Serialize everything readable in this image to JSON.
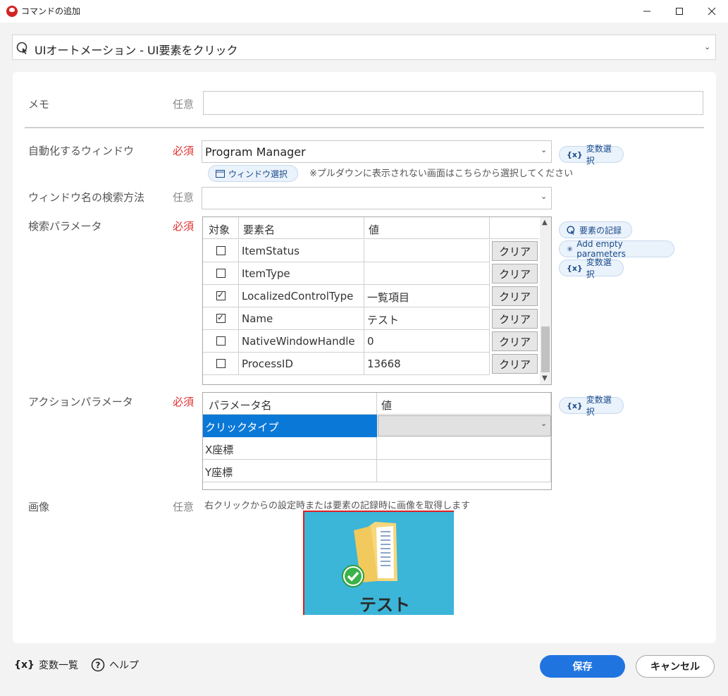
{
  "window": {
    "title": "コマンドの追加"
  },
  "command": {
    "label": "UIオートメーション - UI要素をクリック"
  },
  "memo": {
    "label": "メモ",
    "tag": "任意",
    "value": ""
  },
  "target_window": {
    "label": "自動化するウィンドウ",
    "tag": "必須",
    "value": "Program Manager",
    "var_btn": "変数選択",
    "select_btn": "ウィンドウ選択",
    "hint": "※プルダウンに表示されない画面はこちらから選択してください"
  },
  "search_method": {
    "label": "ウィンドウ名の検索方法",
    "tag": "任意",
    "value": ""
  },
  "search_params": {
    "label": "検索パラメータ",
    "tag": "必須",
    "headers": [
      "対象",
      "要素名",
      "値"
    ],
    "clear_label": "クリア",
    "rows": [
      {
        "checked": false,
        "name": "ItemStatus",
        "value": ""
      },
      {
        "checked": false,
        "name": "ItemType",
        "value": ""
      },
      {
        "checked": true,
        "name": "LocalizedControlType",
        "value": "一覧項目"
      },
      {
        "checked": true,
        "name": "Name",
        "value": "テスト"
      },
      {
        "checked": false,
        "name": "NativeWindowHandle",
        "value": "0"
      },
      {
        "checked": false,
        "name": "ProcessID",
        "value": "13668"
      }
    ],
    "record_btn": "要素の記録",
    "add_empty_btn": "Add empty parameters",
    "var_btn": "変数選択"
  },
  "action_params": {
    "label": "アクションパラメータ",
    "tag": "必須",
    "headers": [
      "パラメータ名",
      "値"
    ],
    "rows": [
      {
        "name": "クリックタイプ",
        "value": ""
      },
      {
        "name": "X座標",
        "value": ""
      },
      {
        "name": "Y座標",
        "value": ""
      }
    ],
    "var_btn": "変数選択"
  },
  "image": {
    "label": "画像",
    "tag": "任意",
    "hint": "右クリックからの設定時または要素の記録時に画像を取得します",
    "caption": "テスト"
  },
  "footer": {
    "var_list": "変数一覧",
    "var_icon": "{x}",
    "help": "ヘルプ",
    "save": "保存",
    "cancel": "キャンセル"
  },
  "colors": {
    "accent": "#1f74e0",
    "required": "#e03030",
    "selected_row": "#0a78d7"
  }
}
